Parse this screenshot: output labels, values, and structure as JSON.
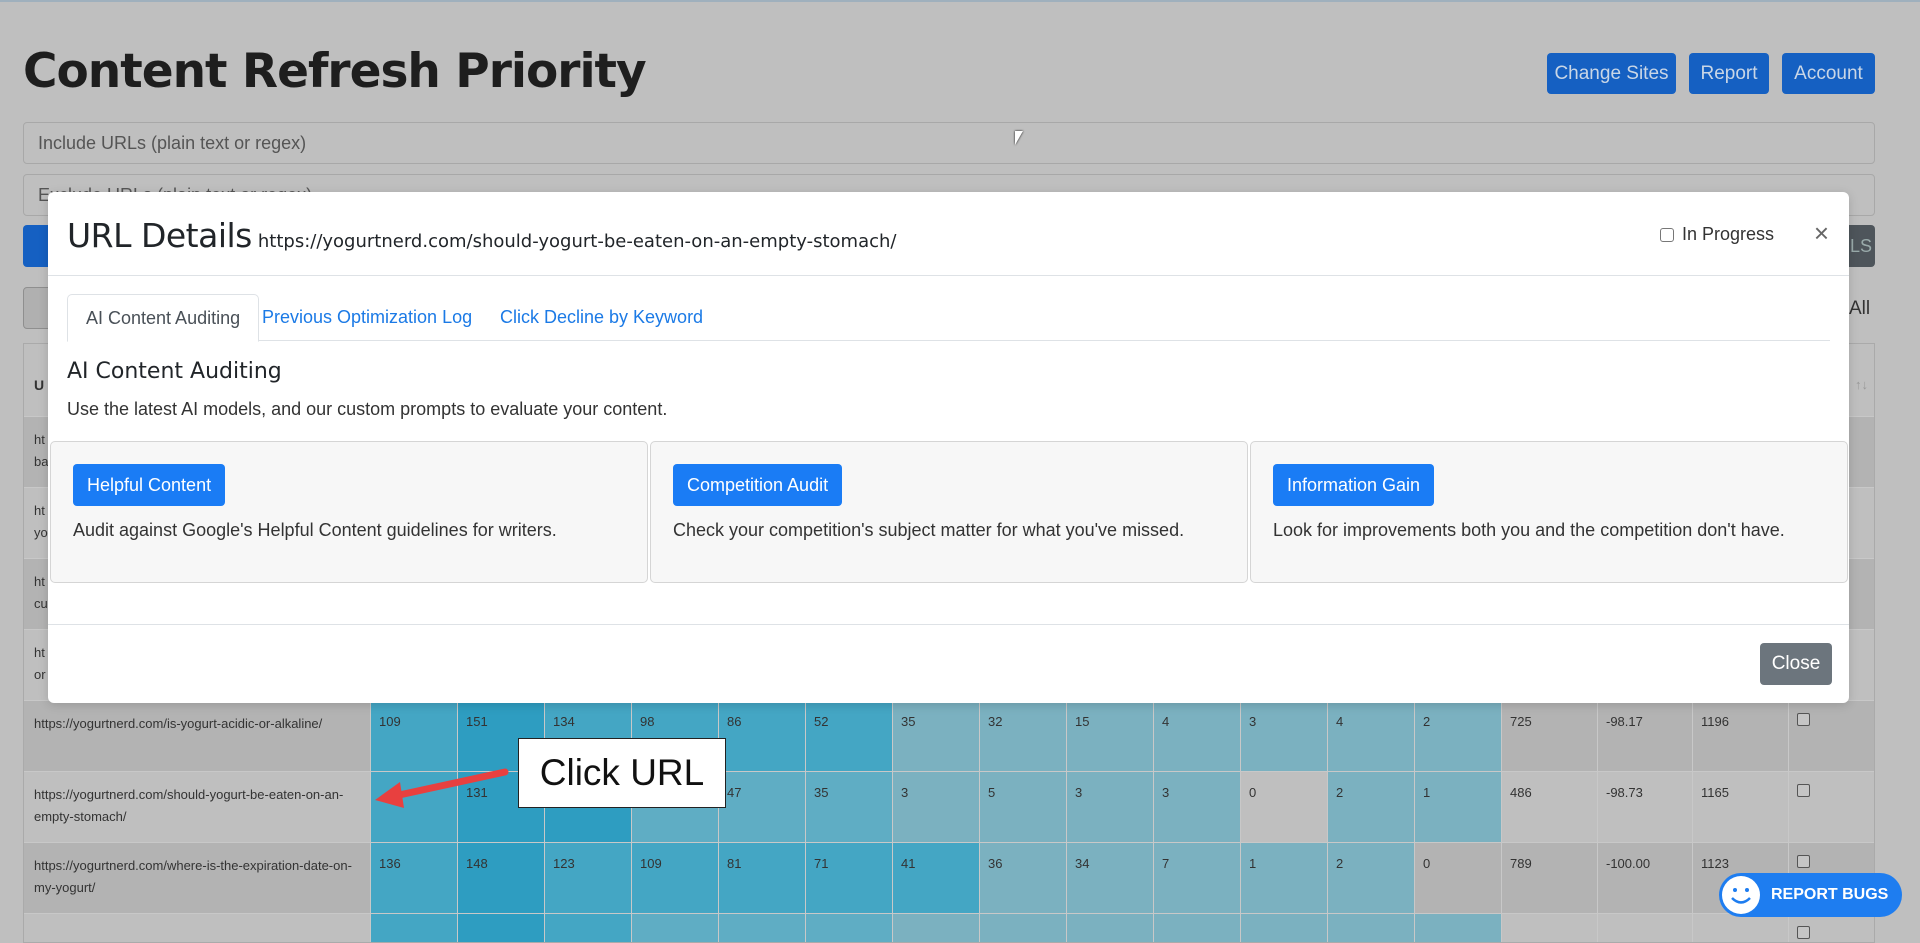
{
  "page": {
    "title": "Content Refresh Priority",
    "header_buttons": [
      "Change Sites",
      "Report",
      "Account"
    ],
    "include_placeholder": "Include URLs (plain text or regex)",
    "exclude_placeholder": "Exclude URLs (plain text or regex)",
    "right_button_fragment": "LS",
    "all_label": "All",
    "table_header_fragment": "U",
    "sort_icon": "↑↓"
  },
  "table": {
    "colors": {
      "0": "#bdbdbd",
      "1": "#7bb1c0",
      "2": "#5fadc4",
      "3": "#44a6c4",
      "4": "#2e9dc1"
    },
    "hidden_rows": [
      [
        "ht",
        "ba"
      ],
      [
        "ht",
        "yo"
      ],
      [
        "ht",
        "cu"
      ],
      [
        "ht",
        "or"
      ]
    ],
    "rows": [
      {
        "url": "https://yogurtnerd.com/is-yogurt-acidic-or-alkaline/",
        "values": [
          "109",
          "151",
          "134",
          "98",
          "86",
          "52",
          "35",
          "32",
          "15",
          "4",
          "3",
          "4",
          "2"
        ],
        "levels": [
          3,
          4,
          3,
          3,
          3,
          3,
          1,
          1,
          1,
          1,
          1,
          1,
          1
        ],
        "totals": [
          "725",
          "-98.17",
          "1196"
        ]
      },
      {
        "url": "https://yogurtnerd.com/should-yogurt-be-eaten-on-an-empty-stomach/",
        "values": [
          "",
          "131",
          "",
          "",
          "47",
          "35",
          "3",
          "5",
          "3",
          "3",
          "0",
          "2",
          "1"
        ],
        "levels": [
          3,
          4,
          4,
          2,
          2,
          2,
          1,
          1,
          1,
          1,
          0,
          1,
          1
        ],
        "totals": [
          "486",
          "-98.73",
          "1165"
        ]
      },
      {
        "url": "https://yogurtnerd.com/where-is-the-expiration-date-on-my-yogurt/",
        "values": [
          "136",
          "148",
          "123",
          "109",
          "81",
          "71",
          "41",
          "36",
          "34",
          "7",
          "1",
          "2",
          "0"
        ],
        "levels": [
          3,
          4,
          3,
          3,
          3,
          3,
          3,
          1,
          1,
          1,
          1,
          1,
          0
        ],
        "totals": [
          "789",
          "-100.00",
          "1123"
        ]
      },
      {
        "url": "",
        "values": [
          "",
          "",
          "",
          "",
          "",
          "",
          "",
          "",
          "",
          "",
          "",
          "",
          ""
        ],
        "levels": [
          3,
          4,
          3,
          2,
          2,
          2,
          1,
          1,
          1,
          1,
          1,
          1,
          1
        ],
        "totals": [
          "",
          "",
          ""
        ]
      }
    ]
  },
  "modal": {
    "title": "URL Details",
    "url": "https://yogurtnerd.com/should-yogurt-be-eaten-on-an-empty-stomach/",
    "in_progress_label": "In Progress",
    "in_progress_checked": false,
    "close_symbol": "×",
    "tabs": [
      {
        "label": "AI Content Auditing",
        "active": true
      },
      {
        "label": "Previous Optimization Log",
        "active": false
      },
      {
        "label": "Click Decline by Keyword",
        "active": false
      }
    ],
    "section_title": "AI Content Auditing",
    "section_desc": "Use the latest AI models, and our custom prompts to evaluate your content.",
    "cards": [
      {
        "button": "Helpful Content",
        "desc": "Audit against Google's Helpful Content guidelines for writers."
      },
      {
        "button": "Competition Audit",
        "desc": "Check your competition's subject matter for what you've missed."
      },
      {
        "button": "Information Gain",
        "desc": "Look for improvements both you and the competition don't have."
      }
    ],
    "close_button": "Close"
  },
  "annotation": {
    "callout": "Click URL",
    "arrow_color": "#e8403f"
  },
  "report_bugs": {
    "label": "REPORT BUGS",
    "color": "#1e7df0"
  }
}
